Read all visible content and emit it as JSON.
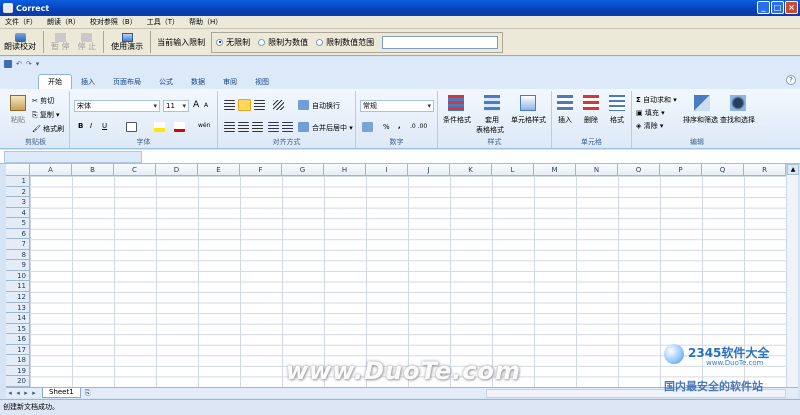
{
  "window": {
    "title": "Correct",
    "minimize": "_",
    "maximize": "□",
    "close": "×"
  },
  "menu": [
    "文件（F）",
    "朗读（R）",
    "校对参照（B）",
    "工具（T）",
    "帮助（H）"
  ],
  "toolbar": {
    "read_proof": "朗读校对",
    "pause": "暂 停",
    "stop": "停 止",
    "demo": "使用演示",
    "limit_label": "当前输入限制",
    "radios": [
      {
        "label": "无限制",
        "checked": true
      },
      {
        "label": "限制为数值",
        "checked": false
      },
      {
        "label": "限制数值范围",
        "checked": false
      }
    ],
    "range_value": ""
  },
  "qat": {
    "undo": "↶",
    "redo": "↷",
    "more": "▾"
  },
  "ribbon_tabs": [
    "开始",
    "插入",
    "页面布局",
    "公式",
    "数据",
    "审阅",
    "视图"
  ],
  "active_tab": "开始",
  "ribbon": {
    "clipboard": {
      "label": "剪贴板",
      "paste": "粘贴",
      "cut": "剪切",
      "copy": "复制",
      "format_painter": "格式刷"
    },
    "font": {
      "label": "字体",
      "name": "宋体",
      "size": "11",
      "grow": "A",
      "shrink": "A",
      "bold": "B",
      "italic": "I",
      "underline": "U",
      "wen": "wén"
    },
    "alignment": {
      "label": "对齐方式",
      "wrap": "自动换行",
      "merge": "合并后居中"
    },
    "number": {
      "label": "数字",
      "format": "常规",
      "percent": "%",
      "comma": ","
    },
    "styles": {
      "label": "样式",
      "cond": "条件格式",
      "table1": "套用",
      "table2": "表格格式",
      "cell": "单元格样式"
    },
    "cells": {
      "label": "单元格",
      "insert": "插入",
      "delete": "删除",
      "format": "格式"
    },
    "editing": {
      "label": "编辑",
      "autosum": "自动求和",
      "fill": "填充",
      "clear": "清除",
      "sort": "排序和筛选",
      "find": "查找和选择"
    }
  },
  "sheet": {
    "columns": [
      "A",
      "B",
      "C",
      "D",
      "E",
      "F",
      "G",
      "H",
      "I",
      "J",
      "K",
      "L",
      "M",
      "N",
      "O",
      "P",
      "Q",
      "R"
    ],
    "rows": [
      "1",
      "2",
      "3",
      "4",
      "5",
      "6",
      "7",
      "8",
      "9",
      "10",
      "11",
      "12",
      "13",
      "14",
      "15",
      "16",
      "17",
      "18",
      "19",
      "20"
    ],
    "tabs": [
      "Sheet1"
    ]
  },
  "status": "创建新文档成功。",
  "watermark": "www.DuoTe.com",
  "brand": {
    "name": "2345软件大全",
    "url": "www.DuoTe.com",
    "slogan": "国内最安全的软件站"
  }
}
